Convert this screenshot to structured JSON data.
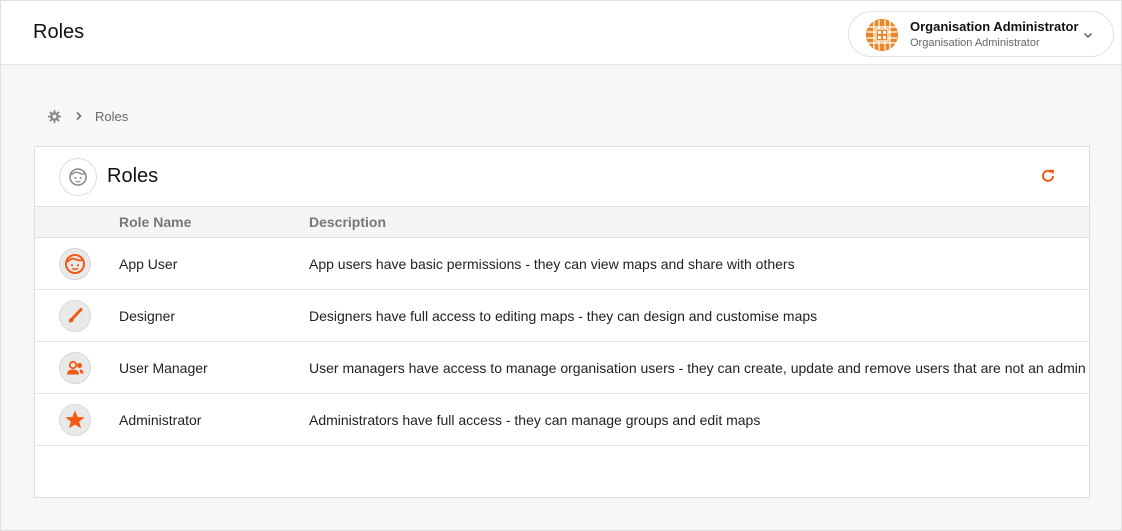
{
  "header": {
    "title": "Roles",
    "user": {
      "name": "Organisation Administrator",
      "role": "Organisation Administrator"
    }
  },
  "breadcrumb": {
    "home_icon": "gear-icon",
    "current": "Roles"
  },
  "card": {
    "icon": "face-icon",
    "title": "Roles",
    "refresh_icon": "refresh-icon"
  },
  "table": {
    "columns": [
      "Role Name",
      "Description"
    ],
    "rows": [
      {
        "icon": "face-icon",
        "name": "App User",
        "description": "App users have basic permissions - they can view maps and share with others"
      },
      {
        "icon": "brush-icon",
        "name": "Designer",
        "description": "Designers have full access to editing maps - they can design and customise maps"
      },
      {
        "icon": "people-icon",
        "name": "User Manager",
        "description": "User managers have access to manage organisation users - they can create, update and remove users that are not an admin"
      },
      {
        "icon": "star-icon",
        "name": "Administrator",
        "description": "Administrators have full access - they can manage groups and edit maps"
      }
    ]
  },
  "colors": {
    "accent": "#f05a14",
    "logo": "#e8872a",
    "muted": "#8a8a8a"
  }
}
